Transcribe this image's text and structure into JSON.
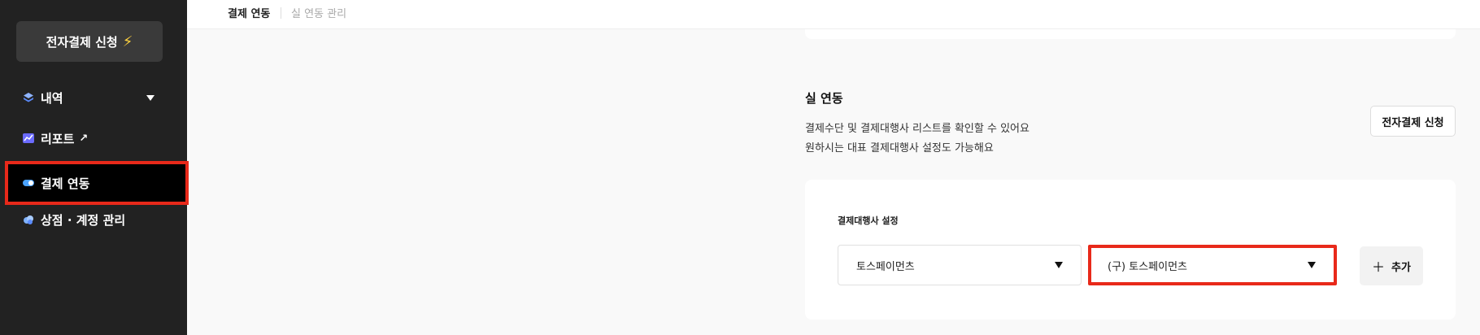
{
  "sidebar": {
    "apply_button": {
      "label": "전자결제 신청",
      "icon": "lightning-icon"
    },
    "items": [
      {
        "label": "내역",
        "icon": "layers-icon",
        "has_dropdown": true
      },
      {
        "label": "리포트",
        "icon": "chart-icon",
        "external": "↗"
      },
      {
        "label": "결제 연동",
        "icon": "toggle-icon",
        "active": true
      },
      {
        "label": "상점 · 계정 관리",
        "icon": "cloud-icon"
      }
    ]
  },
  "tabs": [
    {
      "label": "결제 연동",
      "active": true
    },
    {
      "label": "실 연동 관리",
      "active": false
    }
  ],
  "section": {
    "title": "실 연동",
    "desc_line1": "결제수단 및 결제대행사 리스트를 확인할 수 있어요",
    "desc_line2": "원하시는 대표 결제대행사 설정도 가능해요",
    "apply_button": "전자결제 신청"
  },
  "settings": {
    "label": "결제대행사 설정",
    "select_pg": "토스페이먼츠",
    "select_pg_version": "(구) 토스페이먼츠",
    "add_button": "추가"
  },
  "colors": {
    "highlight": "#e8291a",
    "sidebar_bg": "#222222",
    "accent_bolt": "#ffd23f"
  }
}
